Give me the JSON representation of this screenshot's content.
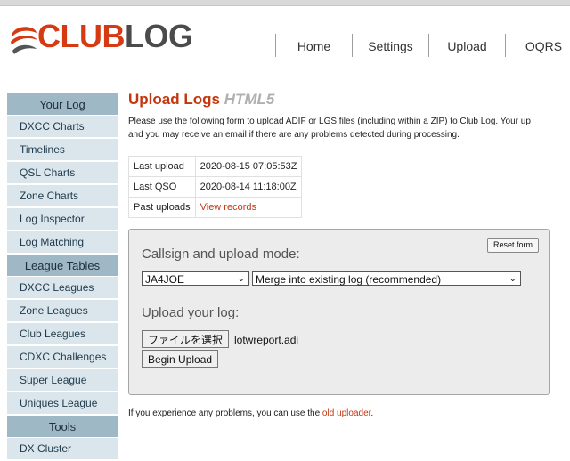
{
  "logo": {
    "part1": "CLUB",
    "part2": "LOG",
    "colors": {
      "club": "#d63a12",
      "log": "#4b4b4b"
    }
  },
  "topnav": [
    "Home",
    "Settings",
    "Upload",
    "OQRS"
  ],
  "sidebar": {
    "sections": [
      {
        "heading": "Your Log",
        "items": [
          "DXCC Charts",
          "Timelines",
          "QSL Charts",
          "Zone Charts",
          "Log Inspector",
          "Log Matching"
        ]
      },
      {
        "heading": "League Tables",
        "items": [
          "DXCC Leagues",
          "Zone Leagues",
          "Club Leagues",
          "CDXC Challenges",
          "Super League",
          "Uniques League"
        ]
      },
      {
        "heading": "Tools",
        "items": [
          "DX Cluster"
        ]
      }
    ]
  },
  "main": {
    "title": "Upload Logs",
    "title_suffix": "HTML5",
    "intro_line1": "Please use the following form to upload ADIF or LGS files (including within a ZIP) to Club Log. Your up",
    "intro_line2": "and you may receive an email if there are any problems detected during processing.",
    "info_table": [
      {
        "label": "Last upload",
        "value": "2020-08-15 07:05:53Z"
      },
      {
        "label": "Last QSO",
        "value": "2020-08-14 11:18:00Z"
      },
      {
        "label": "Past uploads",
        "value": "View records"
      }
    ],
    "upload_form": {
      "mode_heading": "Callsign and upload mode:",
      "reset_label": "Reset form",
      "callsign_value": "JA4JOE",
      "mode_value": "Merge into existing log (recommended)",
      "upload_heading": "Upload your log:",
      "choose_file_label": "ファイルを選択",
      "file_name": "lotwreport.adi",
      "begin_label": "Begin Upload"
    },
    "footer_text": "If you experience any problems, you can use the",
    "footer_link": "old uploader",
    "footer_end": "."
  },
  "colors": {
    "accent": "#c3360e",
    "sidebar_heading": "#9fb8c6",
    "sidebar_item": "#dbe5ec"
  }
}
